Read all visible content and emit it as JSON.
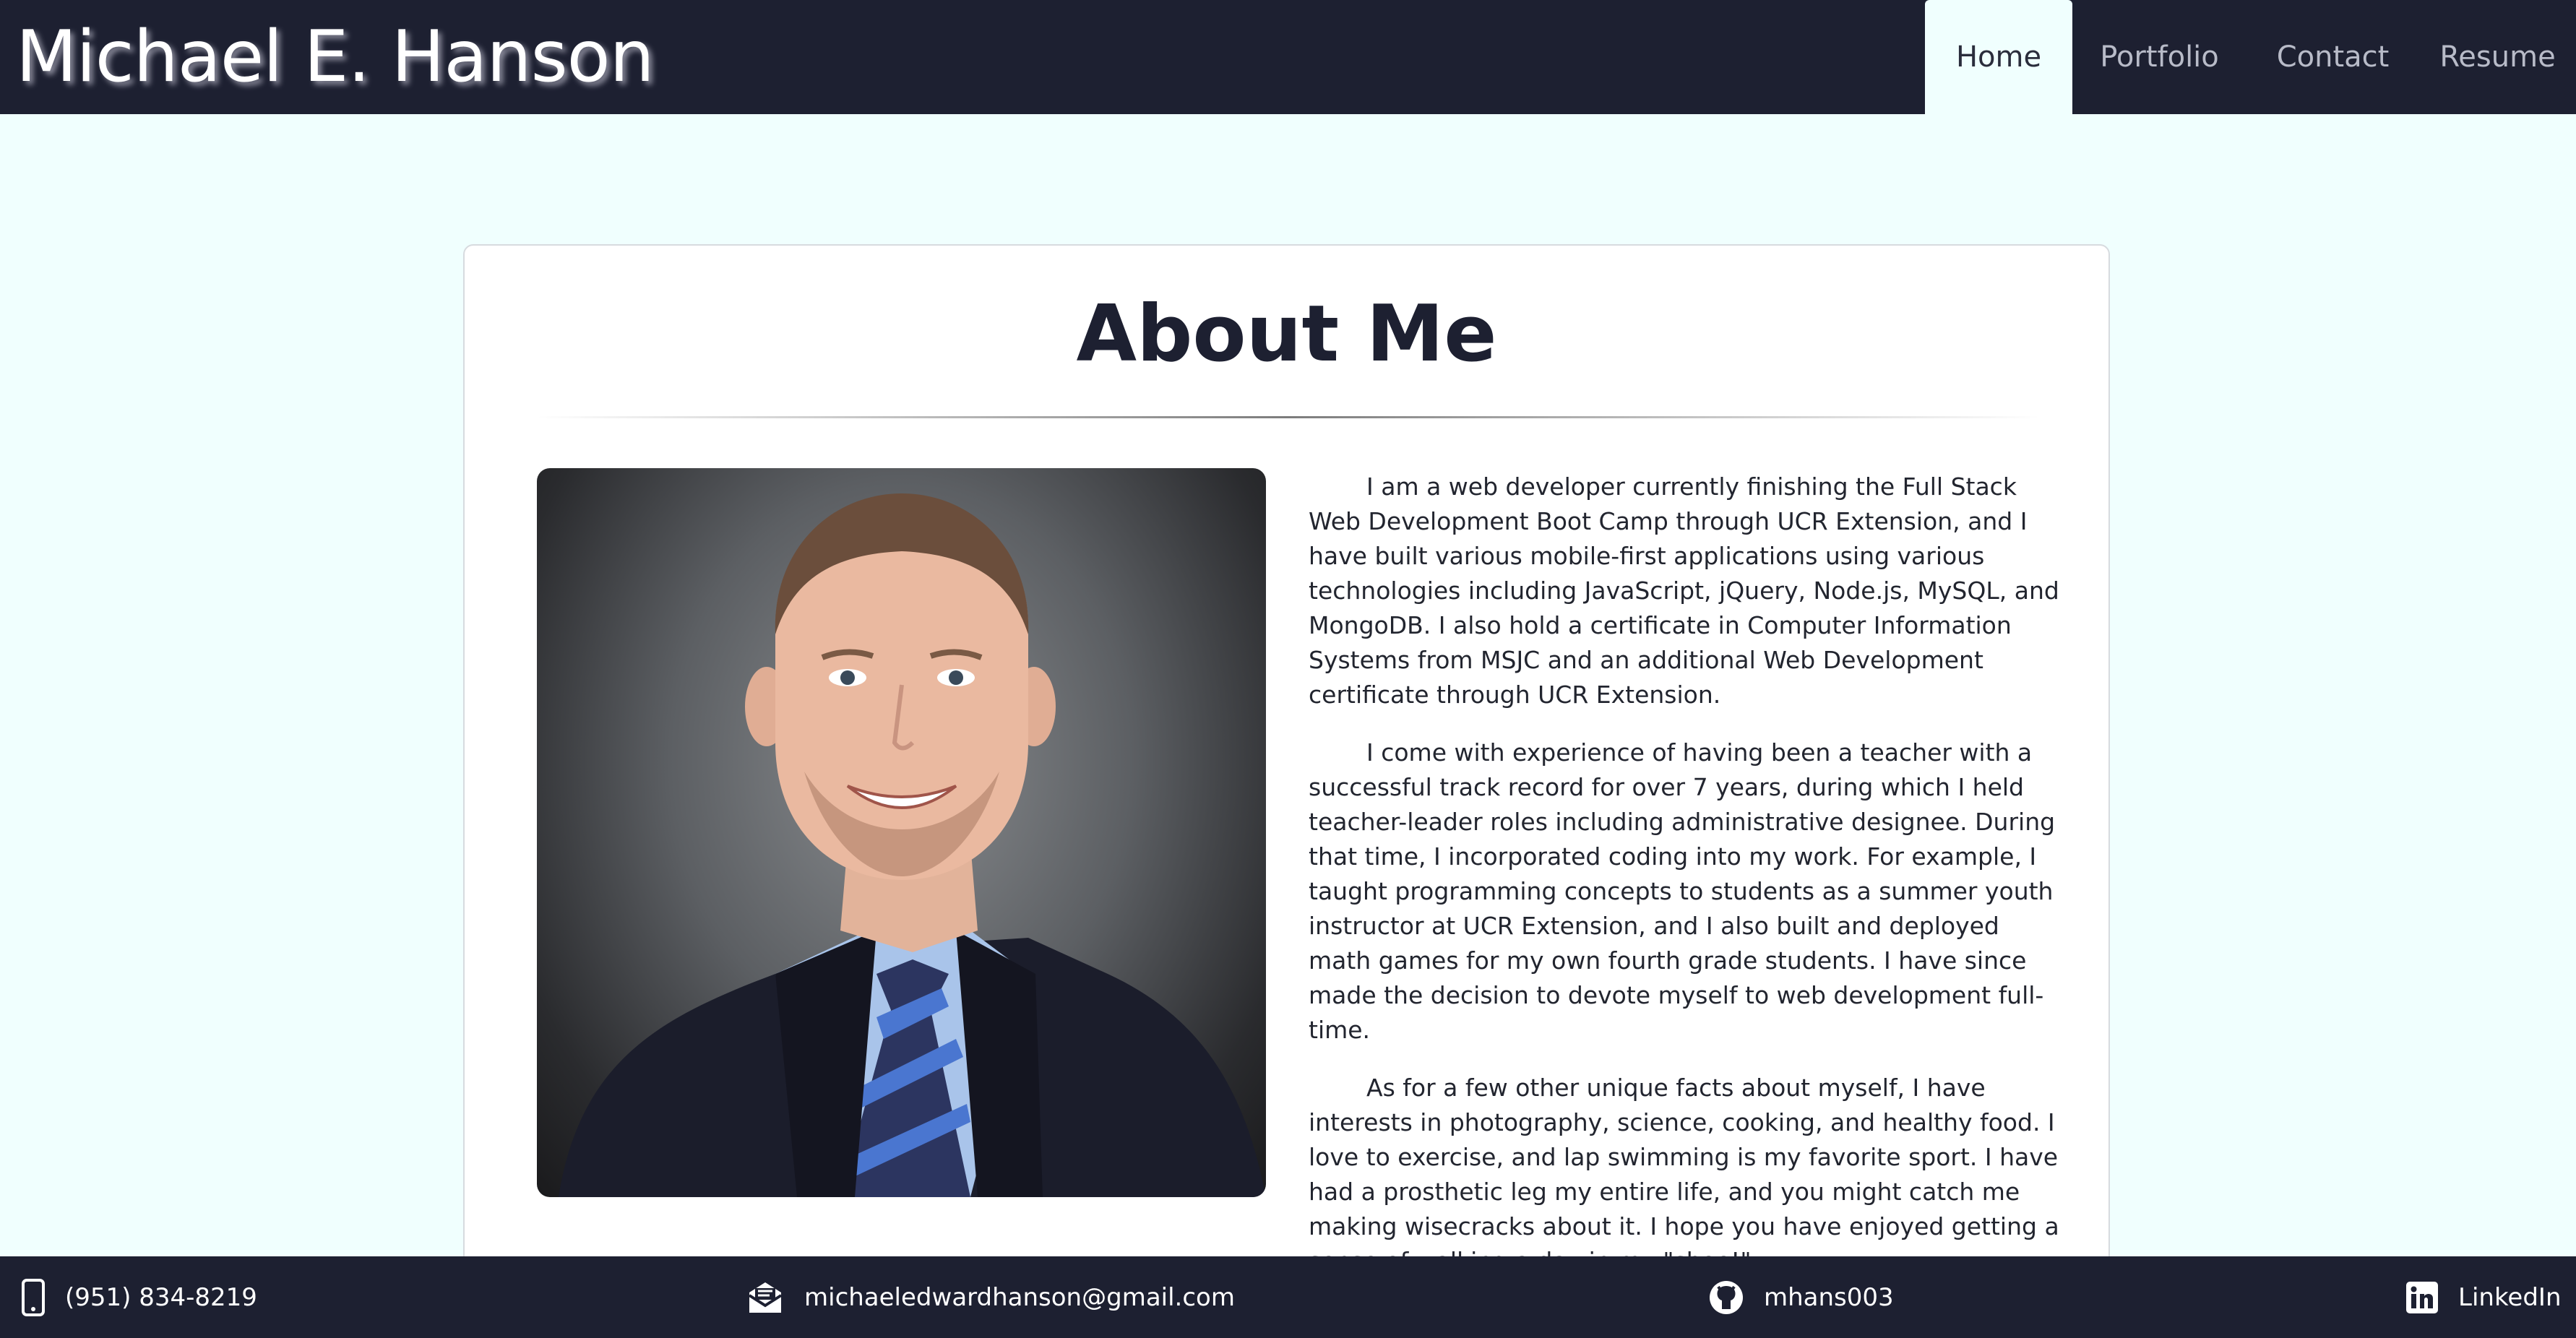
{
  "header": {
    "brand": "Michael E. Hanson",
    "nav": [
      {
        "label": "Home",
        "active": true
      },
      {
        "label": "Portfolio",
        "active": false
      },
      {
        "label": "Contact",
        "active": false
      },
      {
        "label": "Resume",
        "active": false
      }
    ]
  },
  "about": {
    "title": "About Me",
    "photo_icon": "profile-photo",
    "paragraphs": [
      "I am a web developer currently finishing the Full Stack Web Development Boot Camp through UCR Extension, and I have built various mobile-first applications using various technologies including JavaScript, jQuery, Node.js, MySQL, and MongoDB. I also hold a certificate in Computer Information Systems from MSJC and an additional Web Development certificate through UCR Extension.",
      "I come with experience of having been a teacher with a successful track record for over 7 years, during which I held teacher-leader roles including administrative designee. During that time, I incorporated coding into my work. For example, I taught programming concepts to students as a summer youth instructor at UCR Extension, and I also built and deployed math games for my own fourth grade students. I have since made the decision to devote myself to web development full-time.",
      "As for a few other unique facts about myself, I have interests in photography, science, cooking, and healthy food. I love to exercise, and lap swimming is my favorite sport. I have had a prosthetic leg my entire life, and you might catch me making wisecracks about it. I hope you have enjoyed getting a sense of walking a day in my \"shoe!\""
    ]
  },
  "footer": {
    "phone": {
      "icon": "phone-icon",
      "label": "(951) 834-8219"
    },
    "email": {
      "icon": "envelope-icon",
      "label": "michaeledwardhanson@gmail.com"
    },
    "github": {
      "icon": "github-icon",
      "label": "mhans003"
    },
    "linkedin": {
      "icon": "linkedin-icon",
      "label": "LinkedIn"
    }
  },
  "colors": {
    "header_bg": "#1d2031",
    "page_bg": "#f0fffe",
    "card_bg": "#ffffff"
  }
}
